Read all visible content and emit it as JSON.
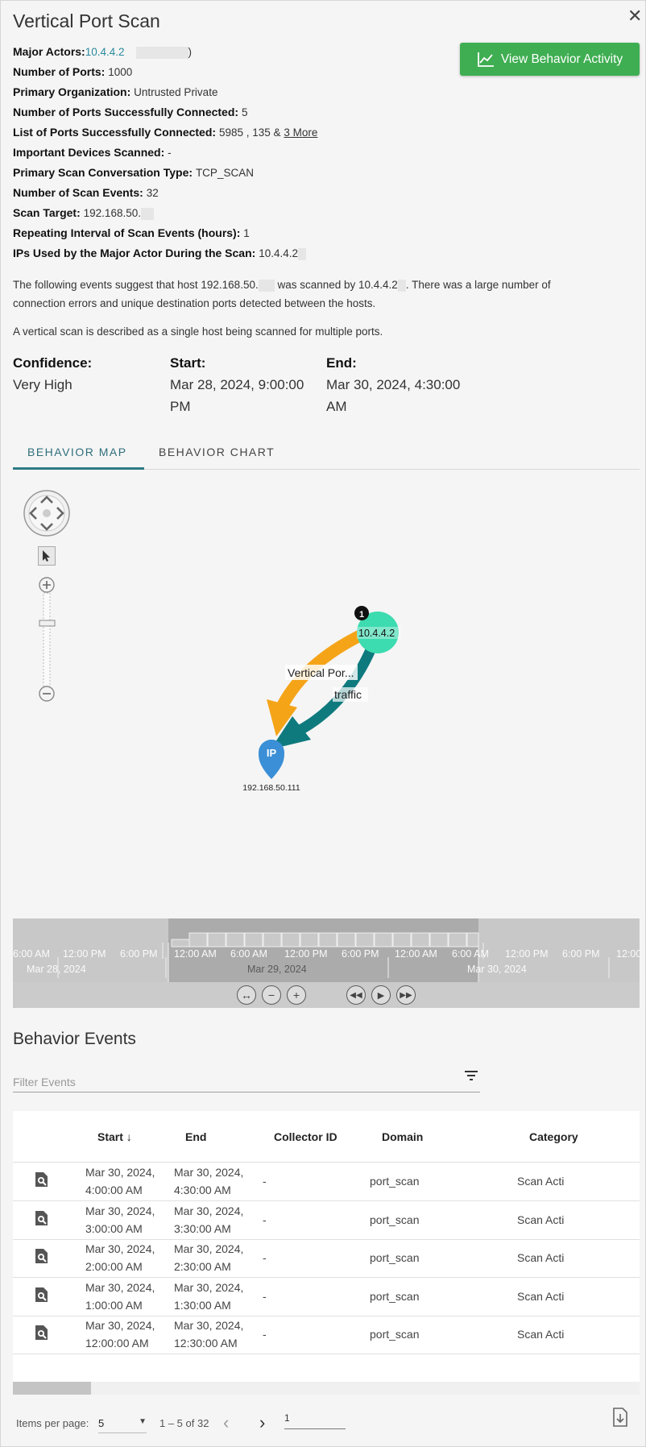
{
  "title": "Vertical Port Scan",
  "close_icon": "close-icon",
  "details": [
    {
      "label": "Major Actors:",
      "value": "10.4.4.2",
      "suffix": ")",
      "type": "actor"
    },
    {
      "label": "Number of Ports:",
      "value": "1000"
    },
    {
      "label": "Primary Organization:",
      "value": "Untrusted Private"
    },
    {
      "label": "Number of Ports Successfully Connected:",
      "value": "5"
    },
    {
      "label": "List of Ports Successfully Connected:",
      "value": "5985 , 135 &",
      "link": "3 More"
    },
    {
      "label": "Important Devices Scanned:",
      "value": "-"
    },
    {
      "label": "Primary Scan Conversation Type:",
      "value": "TCP_SCAN"
    },
    {
      "label": "Number of Scan Events:",
      "value": "32"
    },
    {
      "label": "Scan Target:",
      "value": "192.168.50."
    },
    {
      "label": "Repeating Interval of Scan Events (hours):",
      "value": "1"
    },
    {
      "label": "IPs Used by the Major Actor During the Scan:",
      "value": "10.4.4.2"
    }
  ],
  "view_button": {
    "label": "View Behavior Activity",
    "icon": "line-chart-icon",
    "color": "#3fae52"
  },
  "description": {
    "p1_a": "The following events suggest that host 192.168.50.",
    "p1_b": " was scanned by 10.4.4.2",
    "p1_c": ". There was a large number of",
    "p1_line2": "connection errors and unique destination ports detected between the hosts.",
    "p2": "A vertical scan is described as a single host being scanned for multiple ports."
  },
  "meta": {
    "confidence_label": "Confidence:",
    "confidence_value": "Very High",
    "start_label": "Start:",
    "start_line1": "Mar 28, 2024, 9:00:00",
    "start_line2": "PM",
    "end_label": "End:",
    "end_line1": "Mar 30, 2024, 4:30:00",
    "end_line2": "AM"
  },
  "tabs": [
    "BEHAVIOR MAP",
    "BEHAVIOR CHART"
  ],
  "active_tab": "BEHAVIOR MAP",
  "map": {
    "actor_node": {
      "label": "10.4.4.2",
      "badge": "1",
      "color": "#3ddbb0"
    },
    "target_node": {
      "label": "192.168.50.111",
      "pin_text": "IP",
      "color": "#3b8fd6"
    },
    "edge_scan_label": "Vertical Por...",
    "edge_traffic_label": "traffic",
    "edge_scan_color": "#f5a418",
    "edge_traffic_color": "#0e7a7e"
  },
  "timeline": {
    "times_left": [
      "6:00 AM",
      "12:00 PM",
      "6:00 PM"
    ],
    "times_mid": [
      "12:00 AM",
      "6:00 AM",
      "12:00 PM",
      "6:00 PM",
      "12:00 AM",
      "6:00 AM"
    ],
    "times_right": [
      "12:00 PM",
      "6:00 PM",
      "12:00"
    ],
    "dates": [
      "Mar 28, 2024",
      "Mar 29, 2024",
      "Mar 30, 2024"
    ],
    "controls": [
      "fit-icon",
      "zoom-out-icon",
      "zoom-in-icon",
      "rewind-icon",
      "play-icon",
      "fast-forward-icon"
    ]
  },
  "events": {
    "title": "Behavior Events",
    "filter_placeholder": "Filter Events",
    "columns": [
      "Start",
      "End",
      "Collector ID",
      "Domain",
      "Category"
    ],
    "sort_indicator": "↓",
    "rows": [
      {
        "start1": "Mar 30, 2024,",
        "start2": "4:00:00 AM",
        "end1": "Mar 30, 2024,",
        "end2": "4:30:00 AM",
        "collector": "-",
        "domain": "port_scan",
        "category": "Scan Acti"
      },
      {
        "start1": "Mar 30, 2024,",
        "start2": "3:00:00 AM",
        "end1": "Mar 30, 2024,",
        "end2": "3:30:00 AM",
        "collector": "-",
        "domain": "port_scan",
        "category": "Scan Acti"
      },
      {
        "start1": "Mar 30, 2024,",
        "start2": "2:00:00 AM",
        "end1": "Mar 30, 2024,",
        "end2": "2:30:00 AM",
        "collector": "-",
        "domain": "port_scan",
        "category": "Scan Acti"
      },
      {
        "start1": "Mar 30, 2024,",
        "start2": "1:00:00 AM",
        "end1": "Mar 30, 2024,",
        "end2": "1:30:00 AM",
        "collector": "-",
        "domain": "port_scan",
        "category": "Scan Acti"
      },
      {
        "start1": "Mar 30, 2024,",
        "start2": "12:00:00 AM",
        "end1": "Mar 30, 2024,",
        "end2": "12:30:00 AM",
        "collector": "-",
        "domain": "port_scan",
        "category": "Scan Acti"
      }
    ]
  },
  "pagination": {
    "items_per_page_label": "Items per page:",
    "items_per_page_value": "5",
    "range": "1 – 5 of 32",
    "page_input": "1"
  }
}
